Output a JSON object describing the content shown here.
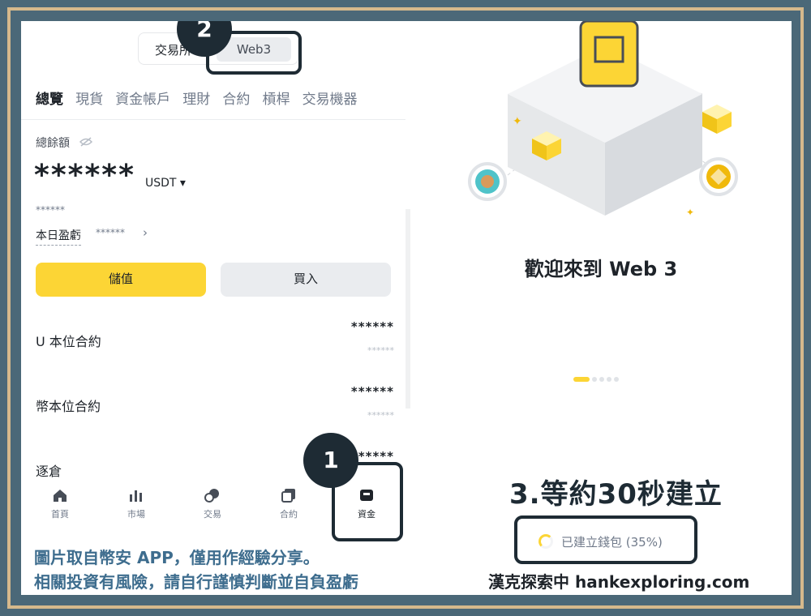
{
  "left_screen": {
    "account_toggle": {
      "exchange_label": "交易所",
      "web3_label": "Web3"
    },
    "tabs": [
      "總覽",
      "現貨",
      "資金帳戶",
      "理財",
      "合約",
      "槓桿",
      "交易機器"
    ],
    "balance": {
      "label": "總餘額",
      "value": "******",
      "unit": "USDT ▾",
      "sub_value": "******",
      "pnl_label": "本日盈虧",
      "pnl_value": "******",
      "pnl_arrow": "›"
    },
    "buttons": {
      "deposit": "儲值",
      "buy": "買入"
    },
    "rows": [
      {
        "title": "U 本位合約",
        "value": "******",
        "sub": "******"
      },
      {
        "title": "幣本位合約",
        "value": "******",
        "sub": "******"
      },
      {
        "title": "逐倉",
        "value": "******"
      }
    ],
    "bottom_nav": [
      {
        "label": "首頁",
        "icon": "home-icon"
      },
      {
        "label": "市場",
        "icon": "market-chart-icon"
      },
      {
        "label": "交易",
        "icon": "trade-icon"
      },
      {
        "label": "合約",
        "icon": "futures-icon"
      },
      {
        "label": "資金",
        "icon": "wallet-icon",
        "active": true
      }
    ]
  },
  "callouts": {
    "step1": "1",
    "step2": "2"
  },
  "right_screen": {
    "welcome_title": "歡迎來到 Web 3",
    "carousel_pages": 5,
    "carousel_active": 0,
    "step3_note": "3.等約30秒建立",
    "wallet_status": "已建立錢包 (35%)",
    "progress": 0.35
  },
  "footer": {
    "disclaimer_line1": "圖片取自幣安  APP，僅用作經驗分享。",
    "disclaimer_line2": "相關投資有風險，請自行謹慎判斷並自負盈虧",
    "brand": "漢克探索中 hankexploring.com"
  },
  "colors": {
    "brand_yellow": "#fcd535",
    "frame_bg": "#4b6878",
    "frame_border": "#d6b98c",
    "callout": "#1e2b34",
    "caption_blue": "#3e6d8e"
  }
}
